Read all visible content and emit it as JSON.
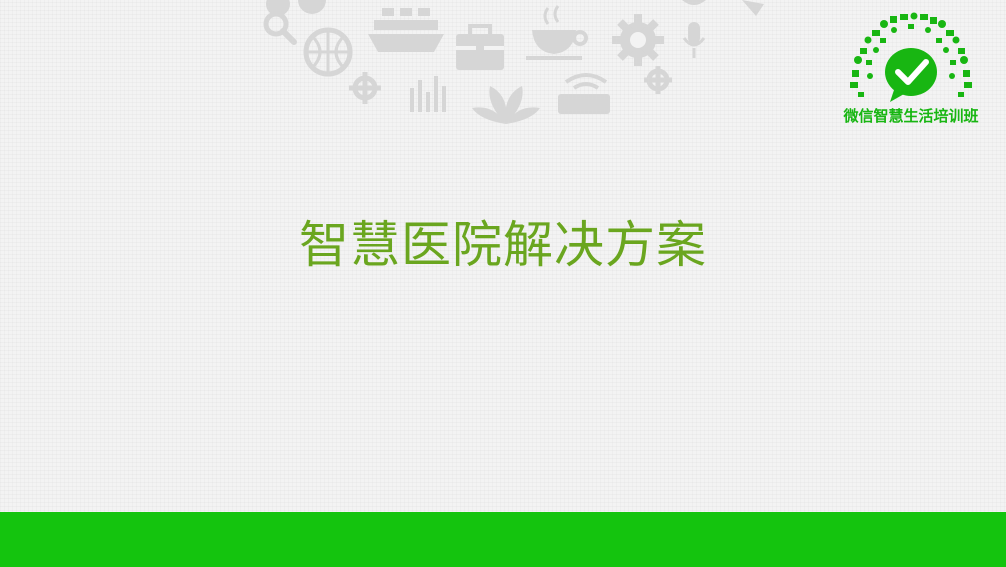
{
  "slide": {
    "title": "智慧医院解决方案"
  },
  "logo": {
    "caption": "微信智慧生活培训班",
    "icon": "wechat-checkmark-bubble-icon"
  },
  "decor_icons": [
    "search-icon",
    "basketball-icon",
    "ship-icon",
    "briefcase-icon",
    "coffee-cup-icon",
    "gear-icon",
    "bar-chart-icon",
    "leaf-icon",
    "keyboard-icon",
    "microphone-icon"
  ],
  "colors": {
    "title": "#6aa61f",
    "accent_green": "#18b612",
    "bottom_bar": "#14c40e",
    "decor_gray": "#d6d6d6",
    "background": "#f3f3f3"
  }
}
